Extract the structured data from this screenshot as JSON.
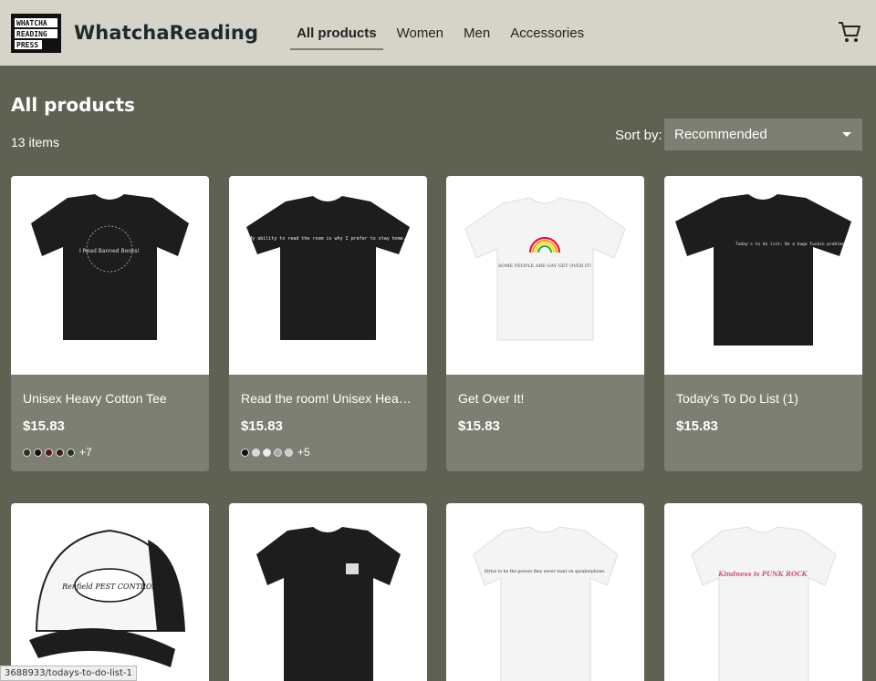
{
  "header": {
    "logo_text": "WHATCHA READING PRESS",
    "brand": "WhatchaReading",
    "nav": [
      "All products",
      "Women",
      "Men",
      "Accessories"
    ],
    "cart_icon": "cart-icon"
  },
  "main": {
    "title": "All products",
    "item_count": "13 items",
    "sort_label": "Sort by:",
    "sort_value": "Recommended"
  },
  "products": [
    {
      "name": "Unisex Heavy Cotton Tee",
      "price": "$15.83",
      "swatches": [
        "#3a2a2a",
        "#111111",
        "#5a1420",
        "#3a1a1a",
        "#1e3322"
      ],
      "more": "+7",
      "print": "I Read Banned Books!"
    },
    {
      "name": "Read the room! Unisex Heavy Cotton Tee",
      "price": "$15.83",
      "swatches": [
        "#111111",
        "#d9d9d9",
        "#eeeeee",
        "#aaaaaa",
        "#cccccc"
      ],
      "more": "+5",
      "print": "My ability to read the room is why I prefer to stay home."
    },
    {
      "name": "Get Over It!",
      "price": "$15.83",
      "swatches": [],
      "more": "",
      "print": "SOME PEOPLE ARE GAY GET OVER IT!"
    },
    {
      "name": "Today's To Do List (1)",
      "price": "$15.83",
      "swatches": [],
      "more": "",
      "print": "Today's to do list: Be a huge fuckin problem"
    },
    {
      "name": "",
      "price": "",
      "swatches": [],
      "more": "",
      "print": "Renfield PEST CONTROL"
    },
    {
      "name": "",
      "price": "",
      "swatches": [],
      "more": "",
      "print": ""
    },
    {
      "name": "",
      "price": "",
      "swatches": [],
      "more": "",
      "print": "Strive to be the person they never want on speakerphone."
    },
    {
      "name": "",
      "price": "",
      "swatches": [],
      "more": "",
      "print": "Kindness is PUNK ROCK"
    }
  ],
  "status_bar": "3688933/todays-to-do-list-1",
  "colors": {
    "header_bg": "#d6d3c8",
    "page_bg": "#5f6253",
    "card_bg": "#7c7f72",
    "brand": "#1e2a2c"
  }
}
